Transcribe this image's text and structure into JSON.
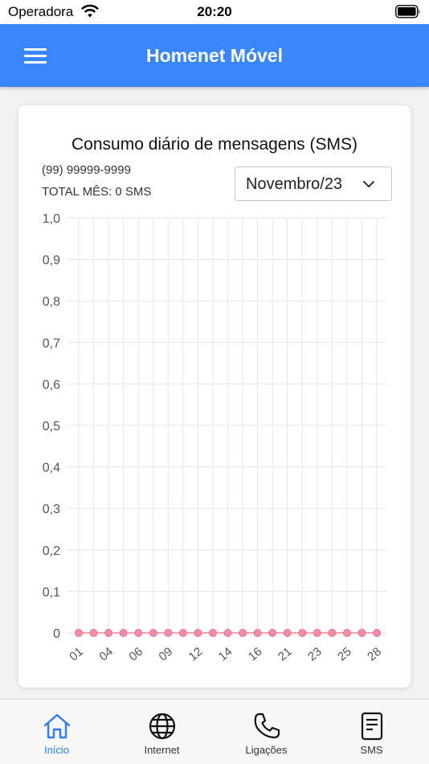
{
  "status": {
    "carrier": "Operadora",
    "time": "20:20"
  },
  "app_bar": {
    "title": "Homenet Móvel"
  },
  "card": {
    "title": "Consumo diário de mensagens (SMS)",
    "phone": "(99) 99999-9999",
    "total": "TOTAL MÊS: 0 SMS",
    "month_selected": "Novembro/23"
  },
  "colors": {
    "brand": "#3a86fb",
    "series_point": "#f48da4",
    "series_line": "#f3a2b4",
    "active_tab": "#2f7bf5"
  },
  "chart_data": {
    "type": "line",
    "title": "Consumo diário de mensagens (SMS)",
    "xlabel": "",
    "ylabel": "",
    "ylim": [
      0,
      1
    ],
    "y_ticks": [
      "0",
      "0,1",
      "0,2",
      "0,3",
      "0,4",
      "0,5",
      "0,6",
      "0,7",
      "0,8",
      "0,9",
      "1,0"
    ],
    "x_tick_labels": [
      "01",
      "04",
      "06",
      "09",
      "12",
      "14",
      "16",
      "21",
      "23",
      "25",
      "28"
    ],
    "x": [
      "01",
      "03",
      "04",
      "05",
      "06",
      "08",
      "09",
      "10",
      "12",
      "13",
      "14",
      "15",
      "16",
      "17",
      "21",
      "22",
      "23",
      "24",
      "25",
      "27",
      "28"
    ],
    "series": [
      {
        "values": [
          0,
          0,
          0,
          0,
          0,
          0,
          0,
          0,
          0,
          0,
          0,
          0,
          0,
          0,
          0,
          0,
          0,
          0,
          0,
          0,
          0
        ]
      }
    ],
    "grid": true
  },
  "tabs": [
    {
      "label": "Início",
      "icon": "home-icon",
      "active": true
    },
    {
      "label": "Internet",
      "icon": "globe-icon",
      "active": false
    },
    {
      "label": "Ligações",
      "icon": "phone-icon",
      "active": false
    },
    {
      "label": "SMS",
      "icon": "sms-icon",
      "active": false
    }
  ]
}
